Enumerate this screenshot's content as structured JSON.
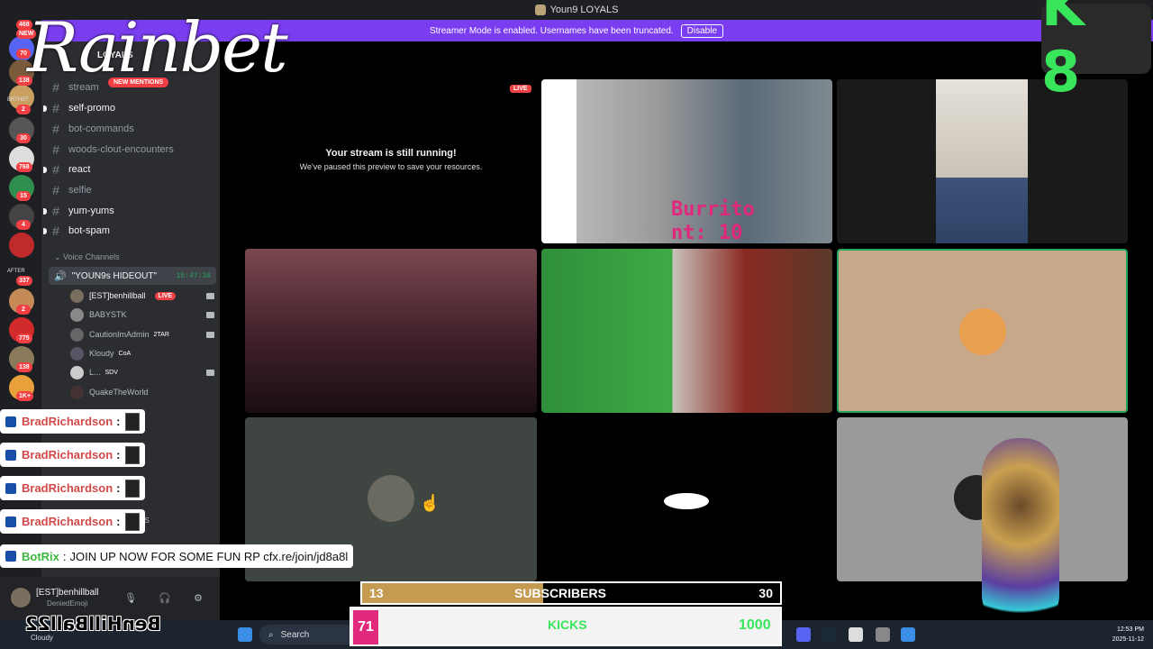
{
  "window": {
    "title": "Youn9 LOYALS"
  },
  "banner": {
    "text": "Streamer Mode is enabled. Usernames have been truncated.",
    "button": "Disable"
  },
  "overlay": {
    "logo": "Rainbet",
    "k8": "K 8"
  },
  "rail": {
    "badges": [
      "468",
      "NEW",
      "70",
      "138",
      "2",
      "30",
      "768",
      "15",
      "4",
      "337",
      "2",
      "775",
      "138",
      "1K+"
    ],
    "labels": [
      "BRTHEF",
      "AFTER"
    ]
  },
  "sidebar": {
    "server_name": "LOYALS",
    "partial_channel": "stream",
    "new_mentions": "NEW MENTIONS",
    "channels": [
      {
        "name": "self-promo",
        "unread": true
      },
      {
        "name": "bot-commands",
        "unread": false
      },
      {
        "name": "woods-clout-encounters",
        "unread": false
      },
      {
        "name": "react",
        "unread": true
      },
      {
        "name": "selfie",
        "unread": false
      },
      {
        "name": "yum-yums",
        "unread": true
      },
      {
        "name": "bot-spam",
        "unread": true
      }
    ],
    "voice_category": "Voice Channels",
    "voice_channel": {
      "name": "\"YOUN9s HIDEOUT\"",
      "timer": "15:47:36"
    },
    "voice_users": [
      {
        "name": "[EST]benhillball",
        "tag": "LIVE"
      },
      {
        "name": "BABYSTK",
        "tag": ""
      },
      {
        "name": "CautionImAdmin",
        "tag": "2TAR"
      },
      {
        "name": "Kloudy",
        "tag": "CoA"
      },
      {
        "name": "L...",
        "tag": "SDV"
      },
      {
        "name": "QuakeTheWorld",
        "tag": ""
      }
    ]
  },
  "chat": {
    "messages": [
      {
        "user": "BradRichardson",
        "sep": ":"
      },
      {
        "user": "BradRichardson",
        "sep": ":"
      },
      {
        "user": "BradRichardson",
        "sep": ":"
      },
      {
        "user": "BradRichardson",
        "sep": ":"
      }
    ],
    "botrix": {
      "user": "BotRix",
      "sep": ":",
      "text": "JOIN UP NOW FOR SOME FUN RP cfx.re/join/jd8a8l"
    },
    "behind_fragment": "YALS"
  },
  "user_panel": {
    "name": "[EST]benhillball",
    "status": "DeniedEmoji"
  },
  "stage": {
    "live_badge": "LIVE",
    "preview_title": "Your stream is still running!",
    "preview_subtitle": "We've paused this preview to save your resources.",
    "burrito_line1": "Burrito",
    "burrito_line2": "nt: 10"
  },
  "subscribers": {
    "current": "13",
    "label": "SUBSCRIBERS",
    "goal": "30",
    "progress": 0.433
  },
  "widget": {
    "left_value": "71",
    "kicks_label": "KICKS",
    "kicks_value": "1000"
  },
  "mirrored_name": "BenHillBall22",
  "taskbar": {
    "search_placeholder": "Search",
    "weather": "Cloudy",
    "time": "12:53 PM",
    "date": "2025-11-12"
  },
  "colors": {
    "brand": "#7a3df0",
    "live": "#ed4245",
    "voice_green": "#23a55a",
    "kick_green": "#39e55b"
  }
}
